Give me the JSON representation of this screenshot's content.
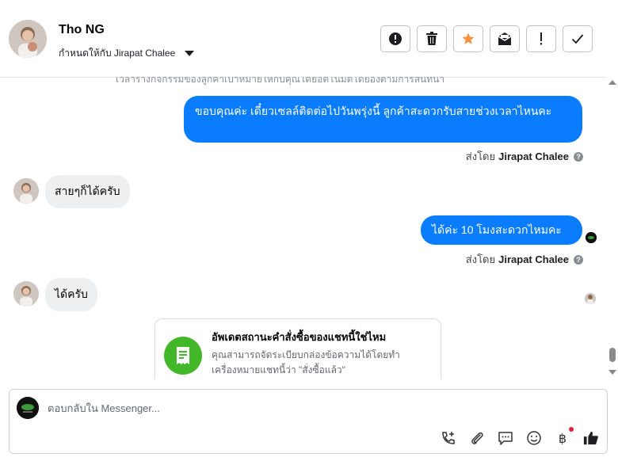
{
  "header": {
    "contact_name": "Tho NG",
    "assign_label": "กำหนดให้กับ Jirapat Chalee",
    "actions": [
      {
        "name": "spam-icon"
      },
      {
        "name": "trash-icon"
      },
      {
        "name": "star-icon",
        "color": "#f7923b"
      },
      {
        "name": "mark-unread-icon"
      },
      {
        "name": "exclamation-icon"
      },
      {
        "name": "check-icon"
      }
    ]
  },
  "chat": {
    "faded_text": "เวลาร่างกิจกรรมของลูกค้าเป้าหมายให้กับคุณโดยอัตโนมัติโดยอิงตามการสนทนา",
    "messages": [
      {
        "from": "page",
        "text": "ขอบคุณค่ะ เดี๋ยวเซลล์ติดต่อไปวันพรุ่งนี้ ลูกค้าสะดวกรับสายช่วงเวลาไหนคะ"
      },
      {
        "from": "customer",
        "text": "สายๆก็ได้ครับ"
      },
      {
        "from": "page",
        "text": "ได้ค่ะ  10 โมงสะดวกไหมคะ"
      },
      {
        "from": "customer",
        "text": "ได้ครับ"
      }
    ],
    "sent_by_prefix": "ส่งโดย",
    "sent_by_name": "Jirapat Chalee",
    "help_glyph": "?",
    "card": {
      "title": "อัพเดตสถานะคำสั่งซื้อของแชทนี้ใช่ไหม",
      "body": "คุณสามารถจัดระเบียบกล่องข้อความได้โดยทำเครื่องหมายแชทนี้ว่า \"สั่งซื้อแล้ว\""
    }
  },
  "composer": {
    "placeholder": "ตอบกลับใน Messenger...",
    "tools": [
      "call-add-icon",
      "attach-icon",
      "saved-reply-icon",
      "emoji-icon",
      "payment-icon",
      "like-icon"
    ],
    "payment_glyph": "฿",
    "accent": "#0a7cff"
  }
}
